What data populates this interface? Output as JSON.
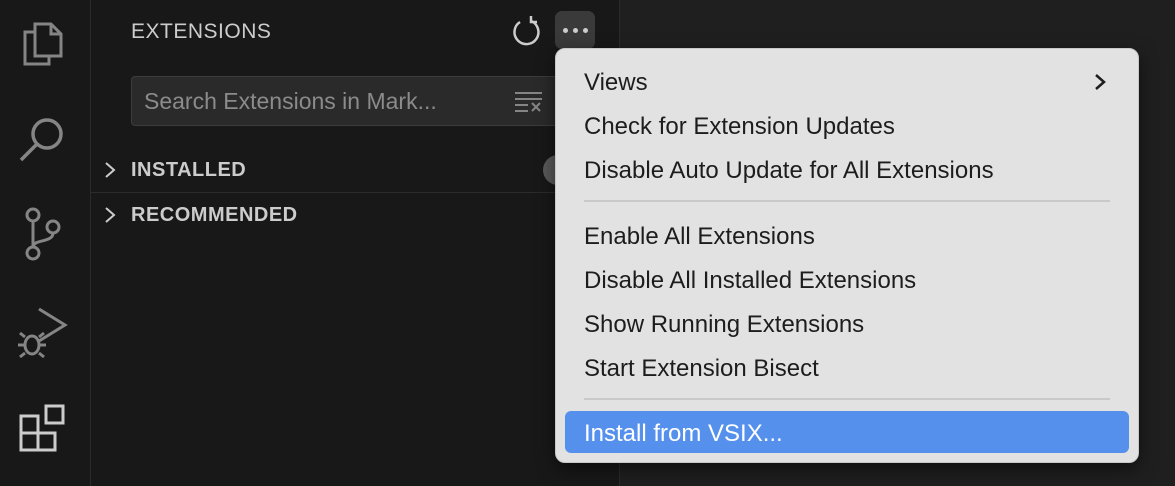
{
  "activity_bar": {
    "icons": [
      "explorer-icon",
      "search-icon",
      "source-control-icon",
      "run-debug-icon",
      "extensions-icon"
    ]
  },
  "sidebar": {
    "title": "EXTENSIONS",
    "search": {
      "placeholder": "Search Extensions in Mark...",
      "value": ""
    },
    "sections": [
      {
        "label": "INSTALLED"
      },
      {
        "label": "RECOMMENDED"
      }
    ]
  },
  "menu": {
    "items": [
      {
        "label": "Views"
      },
      {
        "label": "Check for Extension Updates"
      },
      {
        "label": "Disable Auto Update for All Extensions"
      },
      {
        "label": "Enable All Extensions"
      },
      {
        "label": "Disable All Installed Extensions"
      },
      {
        "label": "Show Running Extensions"
      },
      {
        "label": "Start Extension Bisect"
      },
      {
        "label": "Install from VSIX..."
      }
    ],
    "highlighted": "Install from VSIX..."
  },
  "colors": {
    "highlight": "#5591ec",
    "menu_bg": "#e2e2e2",
    "sidebar_bg": "#181818"
  }
}
